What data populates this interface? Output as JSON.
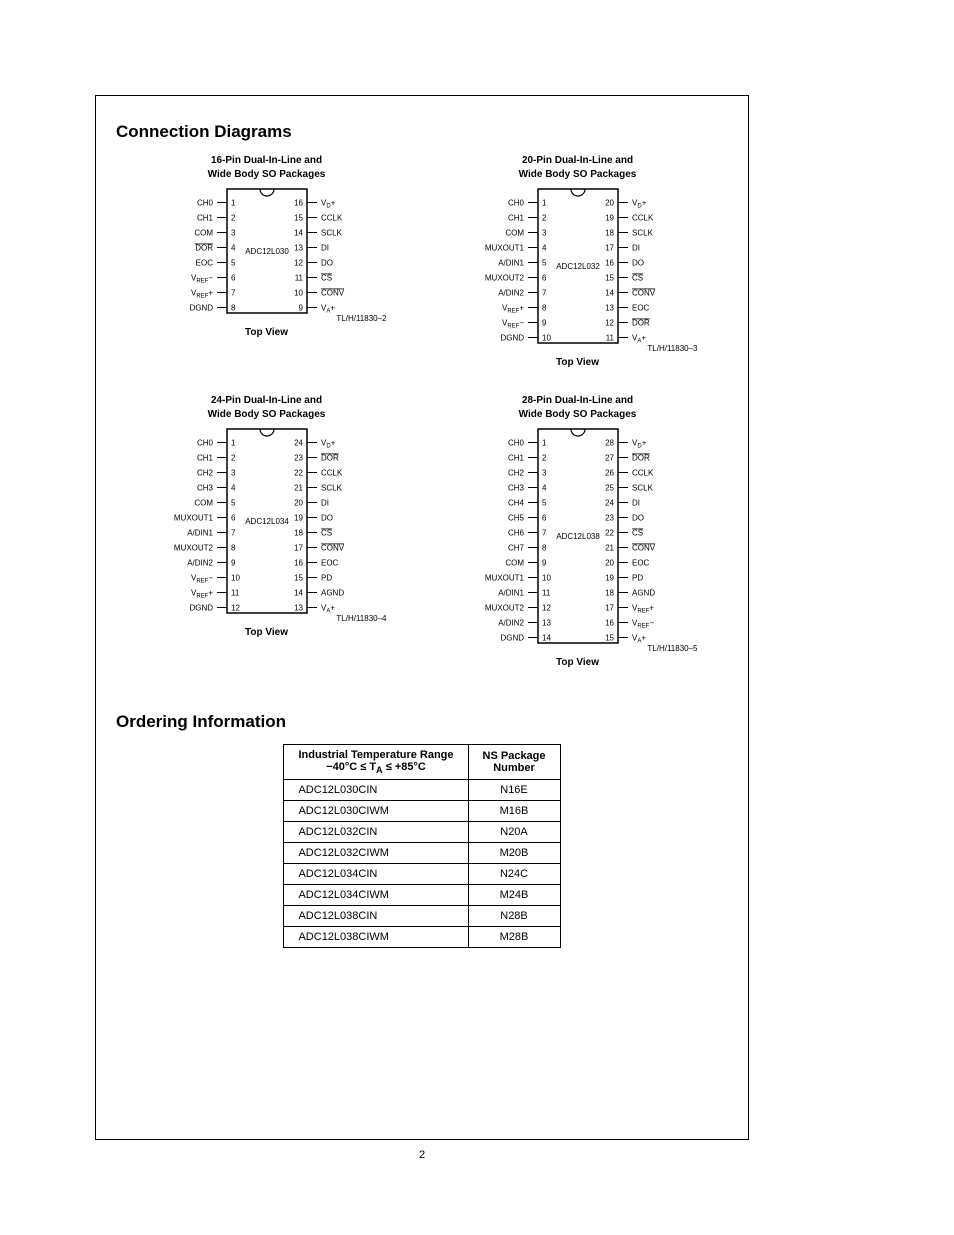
{
  "section1_title": "Connection Diagrams",
  "section2_title": "Ordering Information",
  "page_number": "2",
  "packages": [
    {
      "title1": "16-Pin Dual-In-Line and",
      "title2": "Wide Body SO Packages",
      "part": "ADC12L030",
      "figref": "TL/H/11830–2",
      "topview": "Top View",
      "left": [
        {
          "num": "1",
          "name": "CH0"
        },
        {
          "num": "2",
          "name": "CH1"
        },
        {
          "num": "3",
          "name": "COM"
        },
        {
          "num": "4",
          "name": "DOR",
          "over": true
        },
        {
          "num": "5",
          "name": "EOC"
        },
        {
          "num": "6",
          "name": "V_REF−",
          "special": "vrefm"
        },
        {
          "num": "7",
          "name": "V_REF+",
          "special": "vrefp"
        },
        {
          "num": "8",
          "name": "DGND"
        }
      ],
      "right": [
        {
          "num": "16",
          "name": "V_D+",
          "special": "vd"
        },
        {
          "num": "15",
          "name": "CCLK"
        },
        {
          "num": "14",
          "name": "SCLK"
        },
        {
          "num": "13",
          "name": "DI"
        },
        {
          "num": "12",
          "name": "DO"
        },
        {
          "num": "11",
          "name": "CS",
          "over": true
        },
        {
          "num": "10",
          "name": "CONV",
          "over": true
        },
        {
          "num": "9",
          "name": "V_A+",
          "special": "va"
        }
      ]
    },
    {
      "title1": "20-Pin Dual-In-Line and",
      "title2": "Wide Body SO Packages",
      "part": "ADC12L032",
      "figref": "TL/H/11830–3",
      "topview": "Top View",
      "left": [
        {
          "num": "1",
          "name": "CH0"
        },
        {
          "num": "2",
          "name": "CH1"
        },
        {
          "num": "3",
          "name": "COM"
        },
        {
          "num": "4",
          "name": "MUXOUT1"
        },
        {
          "num": "5",
          "name": "A/DIN1"
        },
        {
          "num": "6",
          "name": "MUXOUT2"
        },
        {
          "num": "7",
          "name": "A/DIN2"
        },
        {
          "num": "8",
          "name": "V_REF+",
          "special": "vrefp"
        },
        {
          "num": "9",
          "name": "V_REF−",
          "special": "vrefm"
        },
        {
          "num": "10",
          "name": "DGND"
        }
      ],
      "right": [
        {
          "num": "20",
          "name": "V_D+",
          "special": "vd"
        },
        {
          "num": "19",
          "name": "CCLK"
        },
        {
          "num": "18",
          "name": "SCLK"
        },
        {
          "num": "17",
          "name": "DI"
        },
        {
          "num": "16",
          "name": "DO"
        },
        {
          "num": "15",
          "name": "CS",
          "over": true
        },
        {
          "num": "14",
          "name": "CONV",
          "over": true
        },
        {
          "num": "13",
          "name": "EOC"
        },
        {
          "num": "12",
          "name": "DOR",
          "over": true
        },
        {
          "num": "11",
          "name": "V_A+",
          "special": "va"
        }
      ]
    },
    {
      "title1": "24-Pin Dual-In-Line and",
      "title2": "Wide Body SO Packages",
      "part": "ADC12L034",
      "figref": "TL/H/11830–4",
      "topview": "Top View",
      "left": [
        {
          "num": "1",
          "name": "CH0"
        },
        {
          "num": "2",
          "name": "CH1"
        },
        {
          "num": "3",
          "name": "CH2"
        },
        {
          "num": "4",
          "name": "CH3"
        },
        {
          "num": "5",
          "name": "COM"
        },
        {
          "num": "6",
          "name": "MUXOUT1"
        },
        {
          "num": "7",
          "name": "A/DIN1"
        },
        {
          "num": "8",
          "name": "MUXOUT2"
        },
        {
          "num": "9",
          "name": "A/DIN2"
        },
        {
          "num": "10",
          "name": "V_REF−",
          "special": "vrefm"
        },
        {
          "num": "11",
          "name": "V_REF+",
          "special": "vrefp"
        },
        {
          "num": "12",
          "name": "DGND"
        }
      ],
      "right": [
        {
          "num": "24",
          "name": "V_D+",
          "special": "vd"
        },
        {
          "num": "23",
          "name": "DOR",
          "over": true
        },
        {
          "num": "22",
          "name": "CCLK"
        },
        {
          "num": "21",
          "name": "SCLK"
        },
        {
          "num": "20",
          "name": "DI"
        },
        {
          "num": "19",
          "name": "DO"
        },
        {
          "num": "18",
          "name": "CS",
          "over": true
        },
        {
          "num": "17",
          "name": "CONV",
          "over": true
        },
        {
          "num": "16",
          "name": "EOC"
        },
        {
          "num": "15",
          "name": "PD"
        },
        {
          "num": "14",
          "name": "AGND"
        },
        {
          "num": "13",
          "name": "V_A+",
          "special": "va"
        }
      ]
    },
    {
      "title1": "28-Pin Dual-In-Line and",
      "title2": "Wide Body SO Packages",
      "part": "ADC12L038",
      "figref": "TL/H/11830–5",
      "topview": "Top View",
      "left": [
        {
          "num": "1",
          "name": "CH0"
        },
        {
          "num": "2",
          "name": "CH1"
        },
        {
          "num": "3",
          "name": "CH2"
        },
        {
          "num": "4",
          "name": "CH3"
        },
        {
          "num": "5",
          "name": "CH4"
        },
        {
          "num": "6",
          "name": "CH5"
        },
        {
          "num": "7",
          "name": "CH6"
        },
        {
          "num": "8",
          "name": "CH7"
        },
        {
          "num": "9",
          "name": "COM"
        },
        {
          "num": "10",
          "name": "MUXOUT1"
        },
        {
          "num": "11",
          "name": "A/DIN1"
        },
        {
          "num": "12",
          "name": "MUXOUT2"
        },
        {
          "num": "13",
          "name": "A/DIN2"
        },
        {
          "num": "14",
          "name": "DGND"
        }
      ],
      "right": [
        {
          "num": "28",
          "name": "V_D+",
          "special": "vd"
        },
        {
          "num": "27",
          "name": "DOR",
          "over": true
        },
        {
          "num": "26",
          "name": "CCLK"
        },
        {
          "num": "25",
          "name": "SCLK"
        },
        {
          "num": "24",
          "name": "DI"
        },
        {
          "num": "23",
          "name": "DO"
        },
        {
          "num": "22",
          "name": "CS",
          "over": true
        },
        {
          "num": "21",
          "name": "CONV",
          "over": true
        },
        {
          "num": "20",
          "name": "EOC"
        },
        {
          "num": "19",
          "name": "PD"
        },
        {
          "num": "18",
          "name": "AGND"
        },
        {
          "num": "17",
          "name": "V_REF+",
          "special": "vrefp"
        },
        {
          "num": "16",
          "name": "V_REF−",
          "special": "vrefm"
        },
        {
          "num": "15",
          "name": "V_A+",
          "special": "va"
        }
      ]
    }
  ],
  "order_table": {
    "head1a": "Industrial Temperature Range",
    "head1b": "−40°C ≤ T_A ≤ +85°C",
    "head2a": "NS Package",
    "head2b": "Number",
    "rows": [
      [
        "ADC12L030CIN",
        "N16E"
      ],
      [
        "ADC12L030CIWM",
        "M16B"
      ],
      [
        "ADC12L032CIN",
        "N20A"
      ],
      [
        "ADC12L032CIWM",
        "M20B"
      ],
      [
        "ADC12L034CIN",
        "N24C"
      ],
      [
        "ADC12L034CIWM",
        "M24B"
      ],
      [
        "ADC12L038CIN",
        "N28B"
      ],
      [
        "ADC12L038CIWM",
        "M28B"
      ]
    ]
  }
}
